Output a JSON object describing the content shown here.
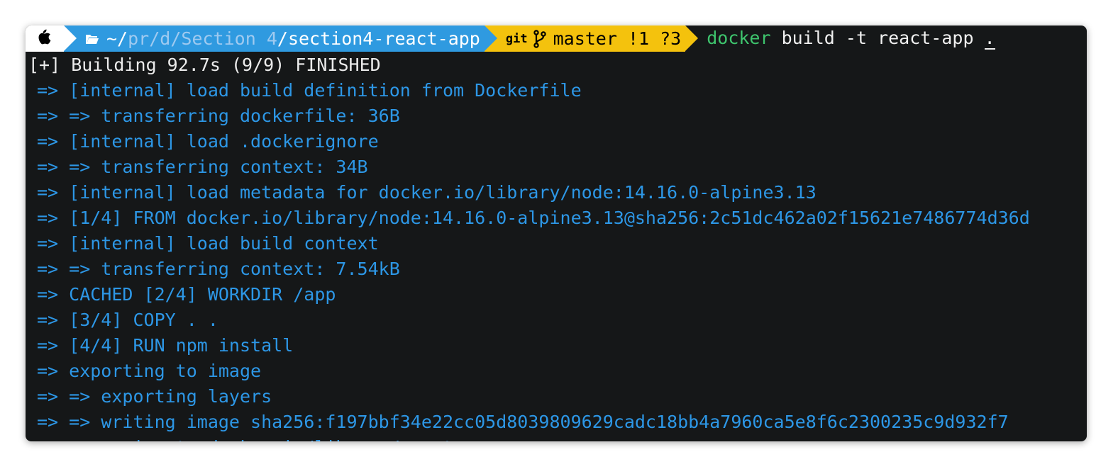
{
  "prompt": {
    "apple_icon": "apple-logo",
    "folder_icon": "folder-open-icon",
    "path_home": "~/",
    "path_pr": "pr",
    "path_sep1": "/",
    "path_d": "d",
    "path_sep2": "/",
    "path_section": "Section 4",
    "path_sep3": "/",
    "path_current": "section4-react-app",
    "git_label": "git",
    "branch_icon": "git-branch-icon",
    "git_branch": "master !1 ?3",
    "command_program": "docker",
    "command_args": " build -t react-app ",
    "command_last": ".",
    "colors": {
      "path_bg": "#2f9ae0",
      "git_bg": "#f4c20d",
      "docker_green": "#3ec46d",
      "terminal_bg": "#151718",
      "step_blue": "#2d97e6"
    }
  },
  "output": {
    "header": "[+] Building 92.7s (9/9) FINISHED",
    "lines": [
      "=> [internal] load build definition from Dockerfile",
      "=> => transferring dockerfile: 36B",
      "=> [internal] load .dockerignore",
      "=> => transferring context: 34B",
      "=> [internal] load metadata for docker.io/library/node:14.16.0-alpine3.13",
      "=> [1/4] FROM docker.io/library/node:14.16.0-alpine3.13@sha256:2c51dc462a02f15621e7486774d36d",
      "=> [internal] load build context",
      "=> => transferring context: 7.54kB",
      "=> CACHED [2/4] WORKDIR /app",
      "=> [3/4] COPY . .",
      "=> [4/4] RUN npm install",
      "=> exporting to image",
      "=> => exporting layers",
      "=> => writing image sha256:f197bbf34e22cc05d8039809629cadc18bb4a7960ca5e8f6c2300235c9d932f7",
      "=> => naming to docker.io/library/react-app"
    ]
  }
}
